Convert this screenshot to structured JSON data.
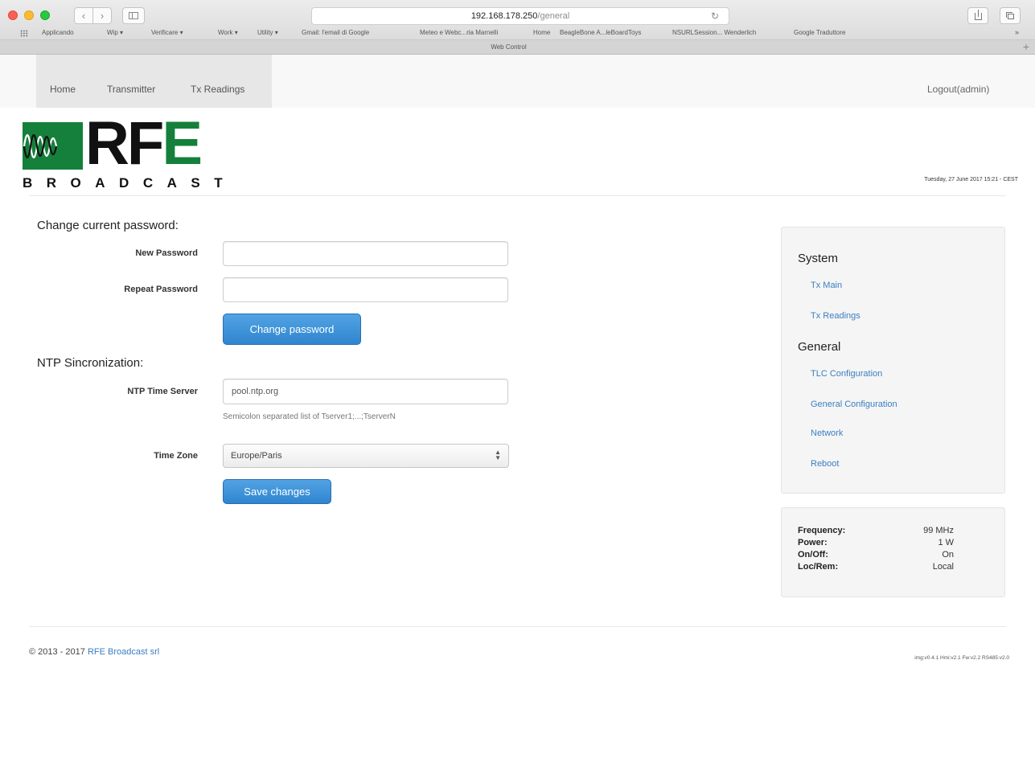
{
  "browser": {
    "url_host": "192.168.178.250",
    "url_path": "/general",
    "reload_icon": "reload-icon",
    "bookmarks": [
      "Applicando",
      "Wip ▾",
      "Verificare ▾",
      "Work ▾",
      "Utility ▾",
      "Gmail: l'email di Google",
      "Meteo e Webc...ria Marnelli",
      "Home",
      "BeagleBone A...leBoardToys",
      "NSURLSession... Wenderlich",
      "Google Traduttore"
    ],
    "bookmarks_more": "»",
    "tab_title": "Web Control"
  },
  "navbar": {
    "items": [
      "Home",
      "Transmitter",
      "Tx Readings"
    ],
    "logout": "Logout(admin)"
  },
  "logo": {
    "text": "RF",
    "text_accent": "E",
    "subtitle": "BROADCAST",
    "brand_green": "#15803b"
  },
  "datetime": "Tuesday, 27 June 2017 15:21 - CEST",
  "password_section": {
    "title": "Change current password:",
    "new_label": "New Password",
    "new_value": "",
    "repeat_label": "Repeat Password",
    "repeat_value": "",
    "button": "Change password"
  },
  "ntp_section": {
    "title": "NTP Sincronization:",
    "server_label": "NTP Time Server",
    "server_value": "pool.ntp.org",
    "server_help": "Semicolon separated list of Tserver1;...;TserverN",
    "timezone_label": "Time Zone",
    "timezone_value": "Europe/Paris",
    "button": "Save changes"
  },
  "sidebar": {
    "system_title": "System",
    "system_links": [
      "Tx Main",
      "Tx Readings"
    ],
    "general_title": "General",
    "general_links": [
      "TLC Configuration",
      "General Configuration",
      "Network",
      "Reboot"
    ],
    "link_color": "#3a7fc1"
  },
  "status": {
    "frequency_label": "Frequency:",
    "frequency_value": "99 MHz",
    "power_label": "Power:",
    "power_value": "1 W",
    "onoff_label": "On/Off:",
    "onoff_value": "On",
    "locrem_label": "Loc/Rem:",
    "locrem_value": "Local"
  },
  "footer": {
    "copyright": "© 2013 - 2017",
    "company": "RFE Broadcast srl",
    "versions": "img:v0.4.1 Hmi:v2.1 Fw:v2.2 RS485:v2.0"
  },
  "accent_button": "#3a8fd8"
}
